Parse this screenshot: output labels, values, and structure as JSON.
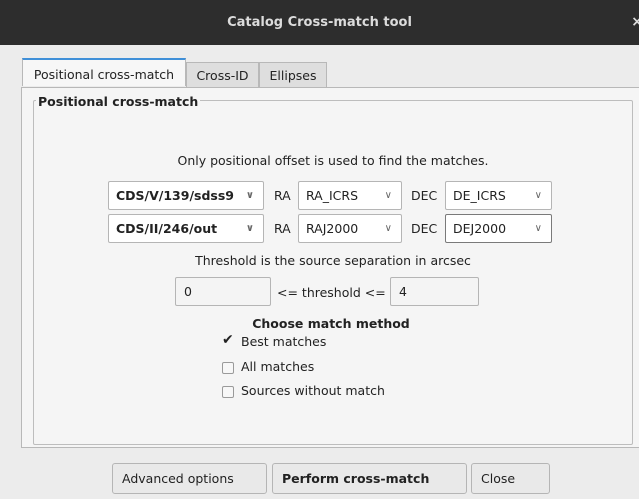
{
  "window": {
    "title": "Catalog Cross-match tool",
    "close_glyph": "×"
  },
  "tabs": [
    {
      "label": "Positional cross-match",
      "active": true
    },
    {
      "label": "Cross-ID",
      "active": false
    },
    {
      "label": "Ellipses",
      "active": false
    }
  ],
  "group": {
    "title": "Positional cross-match"
  },
  "info_text": "Only positional offset is used to find the matches.",
  "rows": [
    {
      "catalog": "CDS/V/139/sdss9",
      "ra_label": "RA",
      "ra_column": "RA_ICRS",
      "dec_label": "DEC",
      "dec_column": "DE_ICRS"
    },
    {
      "catalog": "CDS/II/246/out",
      "ra_label": "RA",
      "ra_column": "RAJ2000",
      "dec_label": "DEC",
      "dec_column": "DEJ2000"
    }
  ],
  "threshold": {
    "label": "Threshold is the source separation in arcsec",
    "min": "0",
    "operator": "<= threshold <=",
    "max": "4"
  },
  "method": {
    "title": "Choose match method",
    "options": [
      {
        "label": "Best matches",
        "checked": true
      },
      {
        "label": "All matches",
        "checked": false
      },
      {
        "label": "Sources without match",
        "checked": false
      }
    ]
  },
  "buttons": {
    "advanced": "Advanced options",
    "perform": "Perform cross-match",
    "close": "Close"
  },
  "icons": {
    "combo_arrow": "chevron-down-icon",
    "checkmark": "checkmark-icon",
    "close": "close-icon"
  }
}
